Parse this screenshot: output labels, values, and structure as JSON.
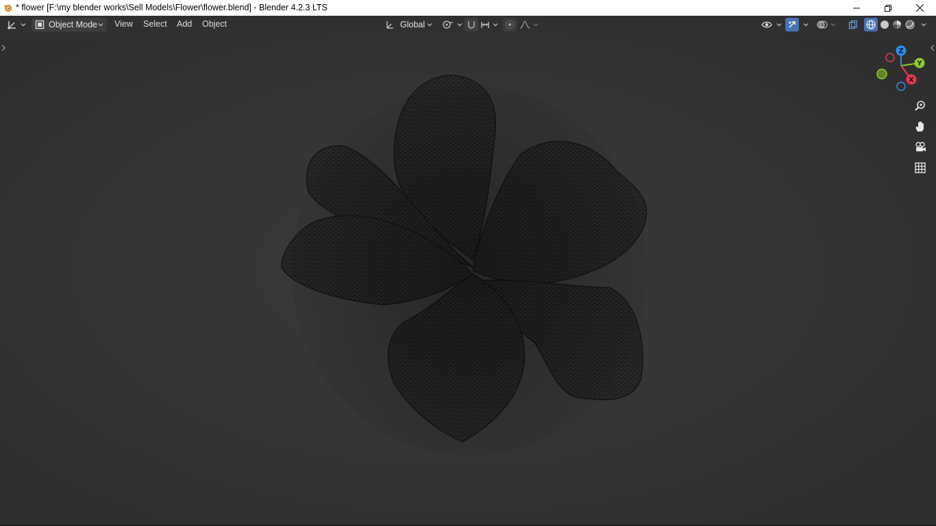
{
  "window": {
    "title": "* flower [F:\\my blender works\\Sell Models\\Flower\\flower.blend] - Blender 4.2.3 LTS"
  },
  "header": {
    "editor_type_icon": "viewport-editor-icon",
    "mode": {
      "label": "Object Mode",
      "icon": "object-mode-icon"
    },
    "menus": [
      "View",
      "Select",
      "Add",
      "Object"
    ],
    "transform_orientation": {
      "label": "Global",
      "icon": "orientation-icon"
    },
    "pivot_icon": "pivot-icon",
    "snap_icon": "magnet-icon",
    "snap_target_icon": "snap-increment-icon",
    "proportional_icon": "proportional-edit-icon",
    "falloff_icon": "falloff-curve-icon",
    "right_icons": [
      "visibility-eye-icon",
      "gizmo-icon",
      "overlay-icon",
      "xray-icon"
    ],
    "shading_modes": [
      "wireframe-shading-icon",
      "solid-shading-icon",
      "material-preview-icon",
      "rendered-shading-icon"
    ]
  },
  "viewport": {
    "nav_gizmo": {
      "axes": [
        "Z",
        "Y",
        "X"
      ]
    },
    "nav_buttons": [
      "zoom-icon",
      "pan-hand-icon",
      "camera-view-icon",
      "grid-ortho-icon"
    ],
    "colors": {
      "x_axis": "#e8394f",
      "y_axis": "#8ccb2a",
      "z_axis": "#2f8cea",
      "background": "#363636"
    }
  }
}
